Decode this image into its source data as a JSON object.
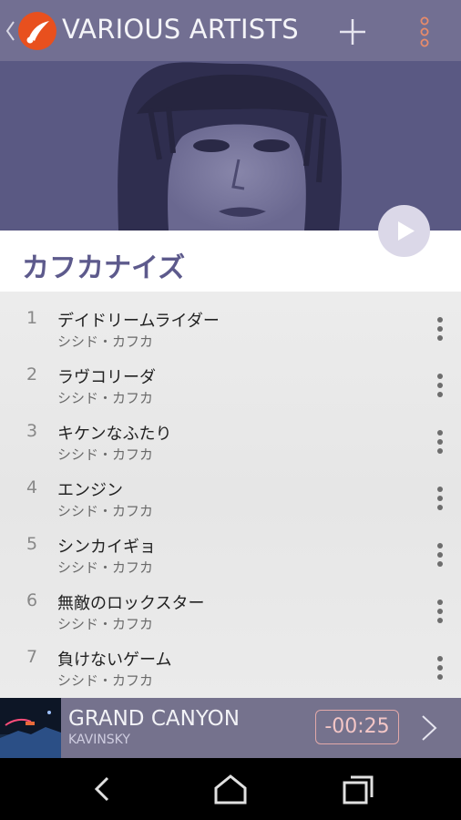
{
  "header": {
    "title": "VARIOUS ARTISTS",
    "back_icon": "chevron-left-icon",
    "logo_icon": "app-logo-icon",
    "add_icon": "plus-icon",
    "more_icon": "more-vertical-icon"
  },
  "album": {
    "title": "カフカナイズ",
    "play_icon": "play-icon"
  },
  "tracks": [
    {
      "number": "1",
      "title": "デイドリームライダー",
      "artist": "シシド・カフカ"
    },
    {
      "number": "2",
      "title": "ラヴコリーダ",
      "artist": "シシド・カフカ"
    },
    {
      "number": "3",
      "title": "キケンなふたり",
      "artist": "シシド・カフカ"
    },
    {
      "number": "4",
      "title": "エンジン",
      "artist": "シシド・カフカ"
    },
    {
      "number": "5",
      "title": "シンカイギョ",
      "artist": "シシド・カフカ"
    },
    {
      "number": "6",
      "title": "無敵のロックスター",
      "artist": "シシド・カフカ"
    },
    {
      "number": "7",
      "title": "負けないゲーム",
      "artist": "シシド・カフカ"
    }
  ],
  "now_playing": {
    "title": "GRAND CANYON",
    "artist": "KAVINSKY",
    "time": "-00:25",
    "next_icon": "chevron-right-icon"
  },
  "nav": {
    "back_icon": "nav-back-icon",
    "home_icon": "nav-home-icon",
    "recents_icon": "nav-recents-icon"
  },
  "colors": {
    "header_bg": "#787696",
    "logo": "#e8501e",
    "album_title": "#5d5a8c",
    "hero_bg": "#5b5a84",
    "player_bg": "#75728d",
    "time_accent": "#f3c6c6"
  }
}
